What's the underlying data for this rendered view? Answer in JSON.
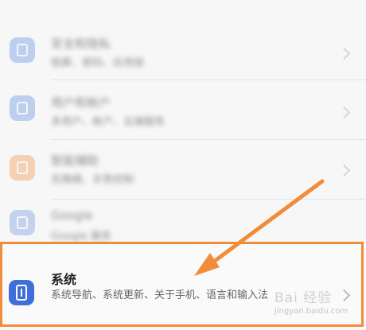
{
  "blurred_items": [
    {
      "title": "安全和隐私",
      "subtitle": "锁屏、密码、应用锁",
      "icon": "shield-icon",
      "color": "#8fb0ea"
    },
    {
      "title": "用户和帐户",
      "subtitle": "多用户、帐户、云端服务",
      "icon": "user-icon",
      "color": "#8fb0ea"
    },
    {
      "title": "智能辅助",
      "subtitle": "无障碍、手势控制",
      "icon": "hand-icon",
      "color": "#f2b37f"
    },
    {
      "title": "Google",
      "subtitle": "Google 服务",
      "icon": "google-icon",
      "color": "#9cb6e6"
    }
  ],
  "system_item": {
    "title": "系统",
    "subtitle": "系统导航、系统更新、关于手机、语言和输入法",
    "icon": "system-icon",
    "color": "#3f6fd8"
  },
  "watermark": {
    "brand": "Bai 经验",
    "url": "jingyan.baidu.com"
  },
  "annotation": {
    "highlight_color": "#ef8d3a"
  }
}
